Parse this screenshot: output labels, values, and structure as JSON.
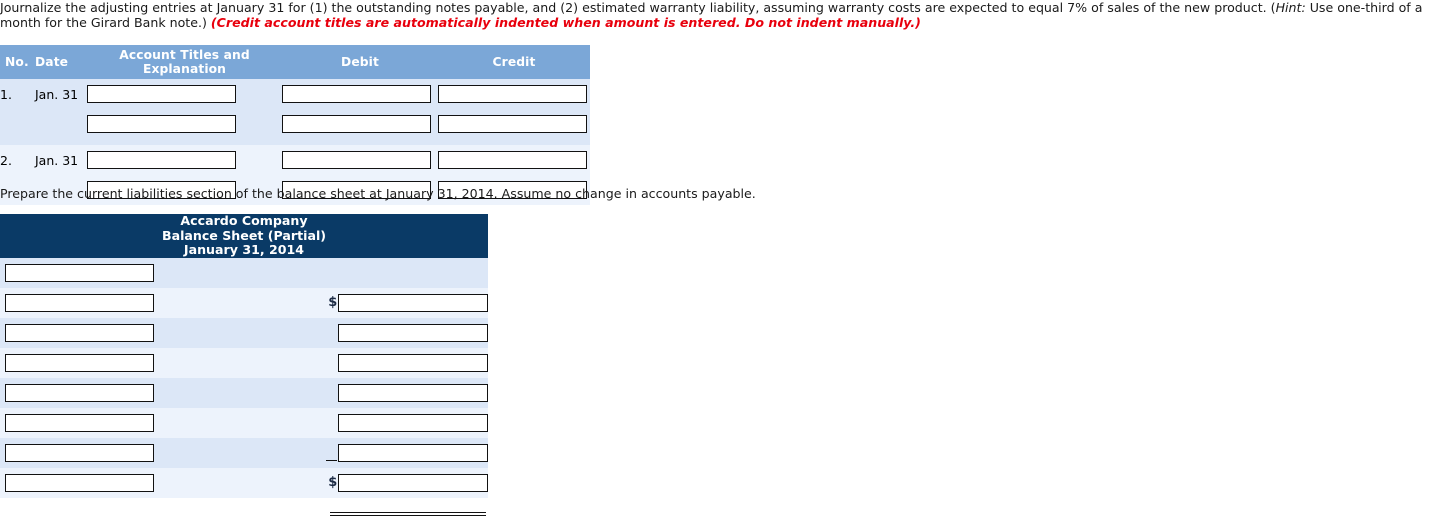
{
  "instructions": {
    "part1": "Journalize the adjusting entries at January 31 for (1) the outstanding notes payable, and (2) estimated warranty liability, assuming warranty costs are expected to equal 7% of sales of the new product. (",
    "hint_label": "Hint:",
    "part2": " Use one-third of a month for the Girard Bank note.) ",
    "red_note": "(Credit account titles are automatically indented when amount is entered. Do not indent manually.)"
  },
  "journal": {
    "headers": {
      "no": "No.",
      "date": "Date",
      "account": "Account Titles and Explanation",
      "debit": "Debit",
      "credit": "Credit"
    },
    "entries": [
      {
        "no": "1.",
        "date": "Jan. 31",
        "lines": [
          {
            "account": "",
            "debit": "",
            "credit": ""
          },
          {
            "account": "",
            "debit": "",
            "credit": ""
          }
        ]
      },
      {
        "no": "2.",
        "date": "Jan. 31",
        "lines": [
          {
            "account": "",
            "debit": "",
            "credit": ""
          },
          {
            "account": "",
            "debit": "",
            "credit": ""
          }
        ]
      }
    ]
  },
  "prompt": "Prepare the current liabilities section of the balance sheet at January 31, 2014. Assume no change in accounts payable.",
  "balance_sheet": {
    "header": {
      "company": "Accardo Company",
      "statement": "Balance Sheet (Partial)",
      "date": "January 31, 2014"
    },
    "rows": [
      {
        "label": "",
        "amount": "",
        "dollar": "",
        "subtotal_rule": false,
        "has_amount": false
      },
      {
        "label": "",
        "amount": "",
        "dollar": "$",
        "subtotal_rule": false,
        "has_amount": true
      },
      {
        "label": "",
        "amount": "",
        "dollar": "",
        "subtotal_rule": false,
        "has_amount": true
      },
      {
        "label": "",
        "amount": "",
        "dollar": "",
        "subtotal_rule": false,
        "has_amount": true
      },
      {
        "label": "",
        "amount": "",
        "dollar": "",
        "subtotal_rule": false,
        "has_amount": true
      },
      {
        "label": "",
        "amount": "",
        "dollar": "",
        "subtotal_rule": false,
        "has_amount": true
      },
      {
        "label": "",
        "amount": "",
        "dollar": "",
        "subtotal_rule": true,
        "has_amount": true
      },
      {
        "label": "",
        "amount": "",
        "dollar": "$",
        "subtotal_rule": false,
        "has_amount": true
      }
    ]
  },
  "colors": {
    "journal_header_blue": "#7BA7D7",
    "balance_header_navy": "#0A3A66",
    "row_band_dark": "#DCE7F7",
    "row_band_light": "#EDF3FC",
    "red_note": "#e8000d"
  }
}
